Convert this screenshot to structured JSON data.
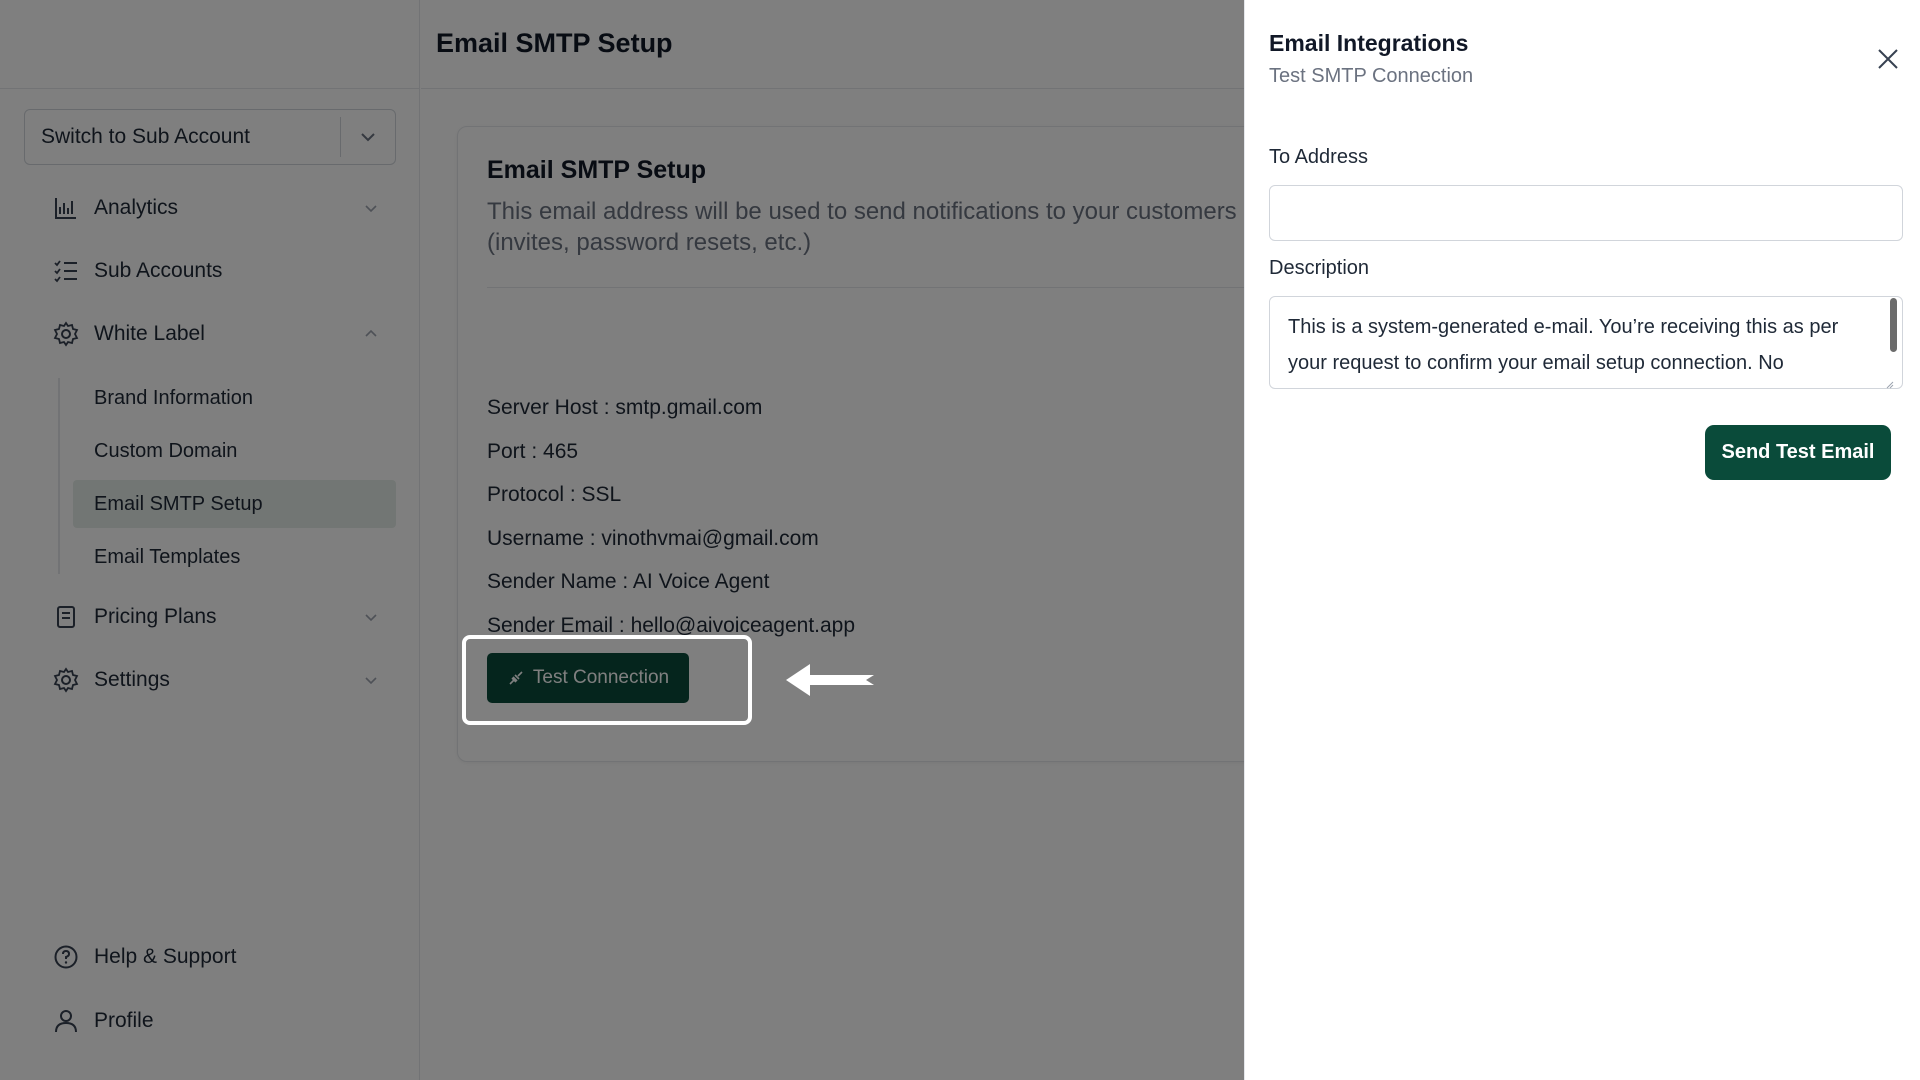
{
  "sidebar": {
    "switch_label": "Switch to Sub Account",
    "items": [
      {
        "label": "Analytics",
        "icon": "bar-chart-icon"
      },
      {
        "label": "Sub Accounts",
        "icon": "checklist-icon"
      },
      {
        "label": "White Label",
        "icon": "gear-icon"
      },
      {
        "label": "Pricing Plans",
        "icon": "receipt-icon"
      },
      {
        "label": "Settings",
        "icon": "gear-icon"
      }
    ],
    "white_label_subitems": [
      {
        "label": "Brand Information"
      },
      {
        "label": "Custom Domain"
      },
      {
        "label": "Email SMTP Setup"
      },
      {
        "label": "Email Templates"
      }
    ],
    "help_label": "Help & Support",
    "profile_label": "Profile"
  },
  "main": {
    "page_title": "Email SMTP Setup",
    "card_title": "Email SMTP Setup",
    "card_description": "This email address will be used to send notifications to your customers (invites, password resets, etc.)",
    "details": {
      "server_host": "Server Host : smtp.gmail.com",
      "port": "Port : 465",
      "protocol": "Protocol : SSL",
      "username": "Username : vinothvmai@gmail.com",
      "sender_name": "Sender Name : AI Voice Agent",
      "sender_email": "Sender Email : hello@aivoiceagent.app"
    },
    "test_button_label": "Test Connection"
  },
  "drawer": {
    "title": "Email Integrations",
    "subtitle": "Test SMTP Connection",
    "to_label": "To Address",
    "to_value": "",
    "description_label": "Description",
    "description_value": "This is a system-generated e-mail. You’re receiving this as per your request to confirm your email setup connection. No",
    "send_button_label": "Send Test Email"
  },
  "colors": {
    "brand": "#0a4b3a",
    "active_item_bg": "#e5ede8",
    "overlay": "rgba(0,0,0,0.5)"
  }
}
